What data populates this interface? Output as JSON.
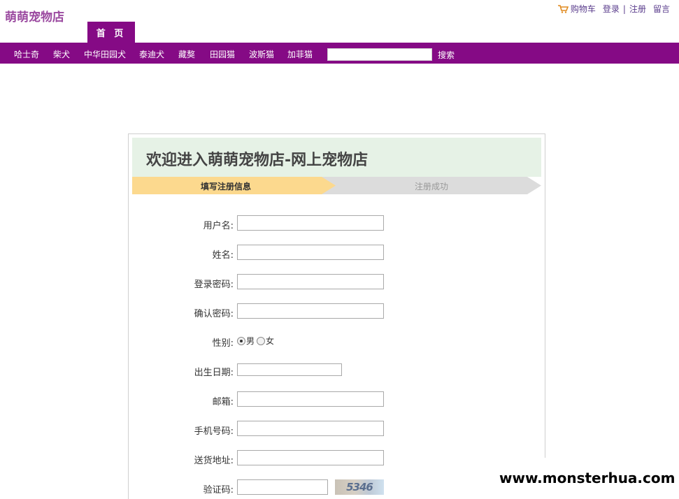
{
  "header": {
    "logo": "萌萌宠物店",
    "links": {
      "cart": "购物车",
      "login": "登录",
      "separator": "|",
      "register": "注册",
      "message": "留言"
    },
    "home_tab": "首 页"
  },
  "nav": {
    "items": [
      "哈士奇",
      "柴犬",
      "中华田园犬",
      "泰迪犬",
      "藏獒",
      "田园猫",
      "波斯猫",
      "加菲猫"
    ],
    "search_value": "",
    "search_button": "搜索"
  },
  "panel": {
    "title": "欢迎进入萌萌宠物店-网上宠物店",
    "steps": {
      "step1": "填写注册信息",
      "step2": "注册成功"
    }
  },
  "form": {
    "username_label": "用户名:",
    "name_label": "姓名:",
    "password_label": "登录密码:",
    "confirm_label": "确认密码:",
    "gender_label": "性别:",
    "gender_male": "男",
    "gender_female": "女",
    "gender_selected": "男",
    "birth_label": "出生日期:",
    "email_label": "邮箱:",
    "phone_label": "手机号码:",
    "address_label": "送货地址:",
    "captcha_label": "验证码:",
    "captcha_text": "5346"
  },
  "watermark": "www.monsterhua.com",
  "colors": {
    "nav_purple": "#850a85",
    "logo_purple": "#9b4aa0",
    "step_active": "#fcd98e",
    "step_inactive": "#dcdcdc",
    "title_bg": "#e6f2e6"
  }
}
